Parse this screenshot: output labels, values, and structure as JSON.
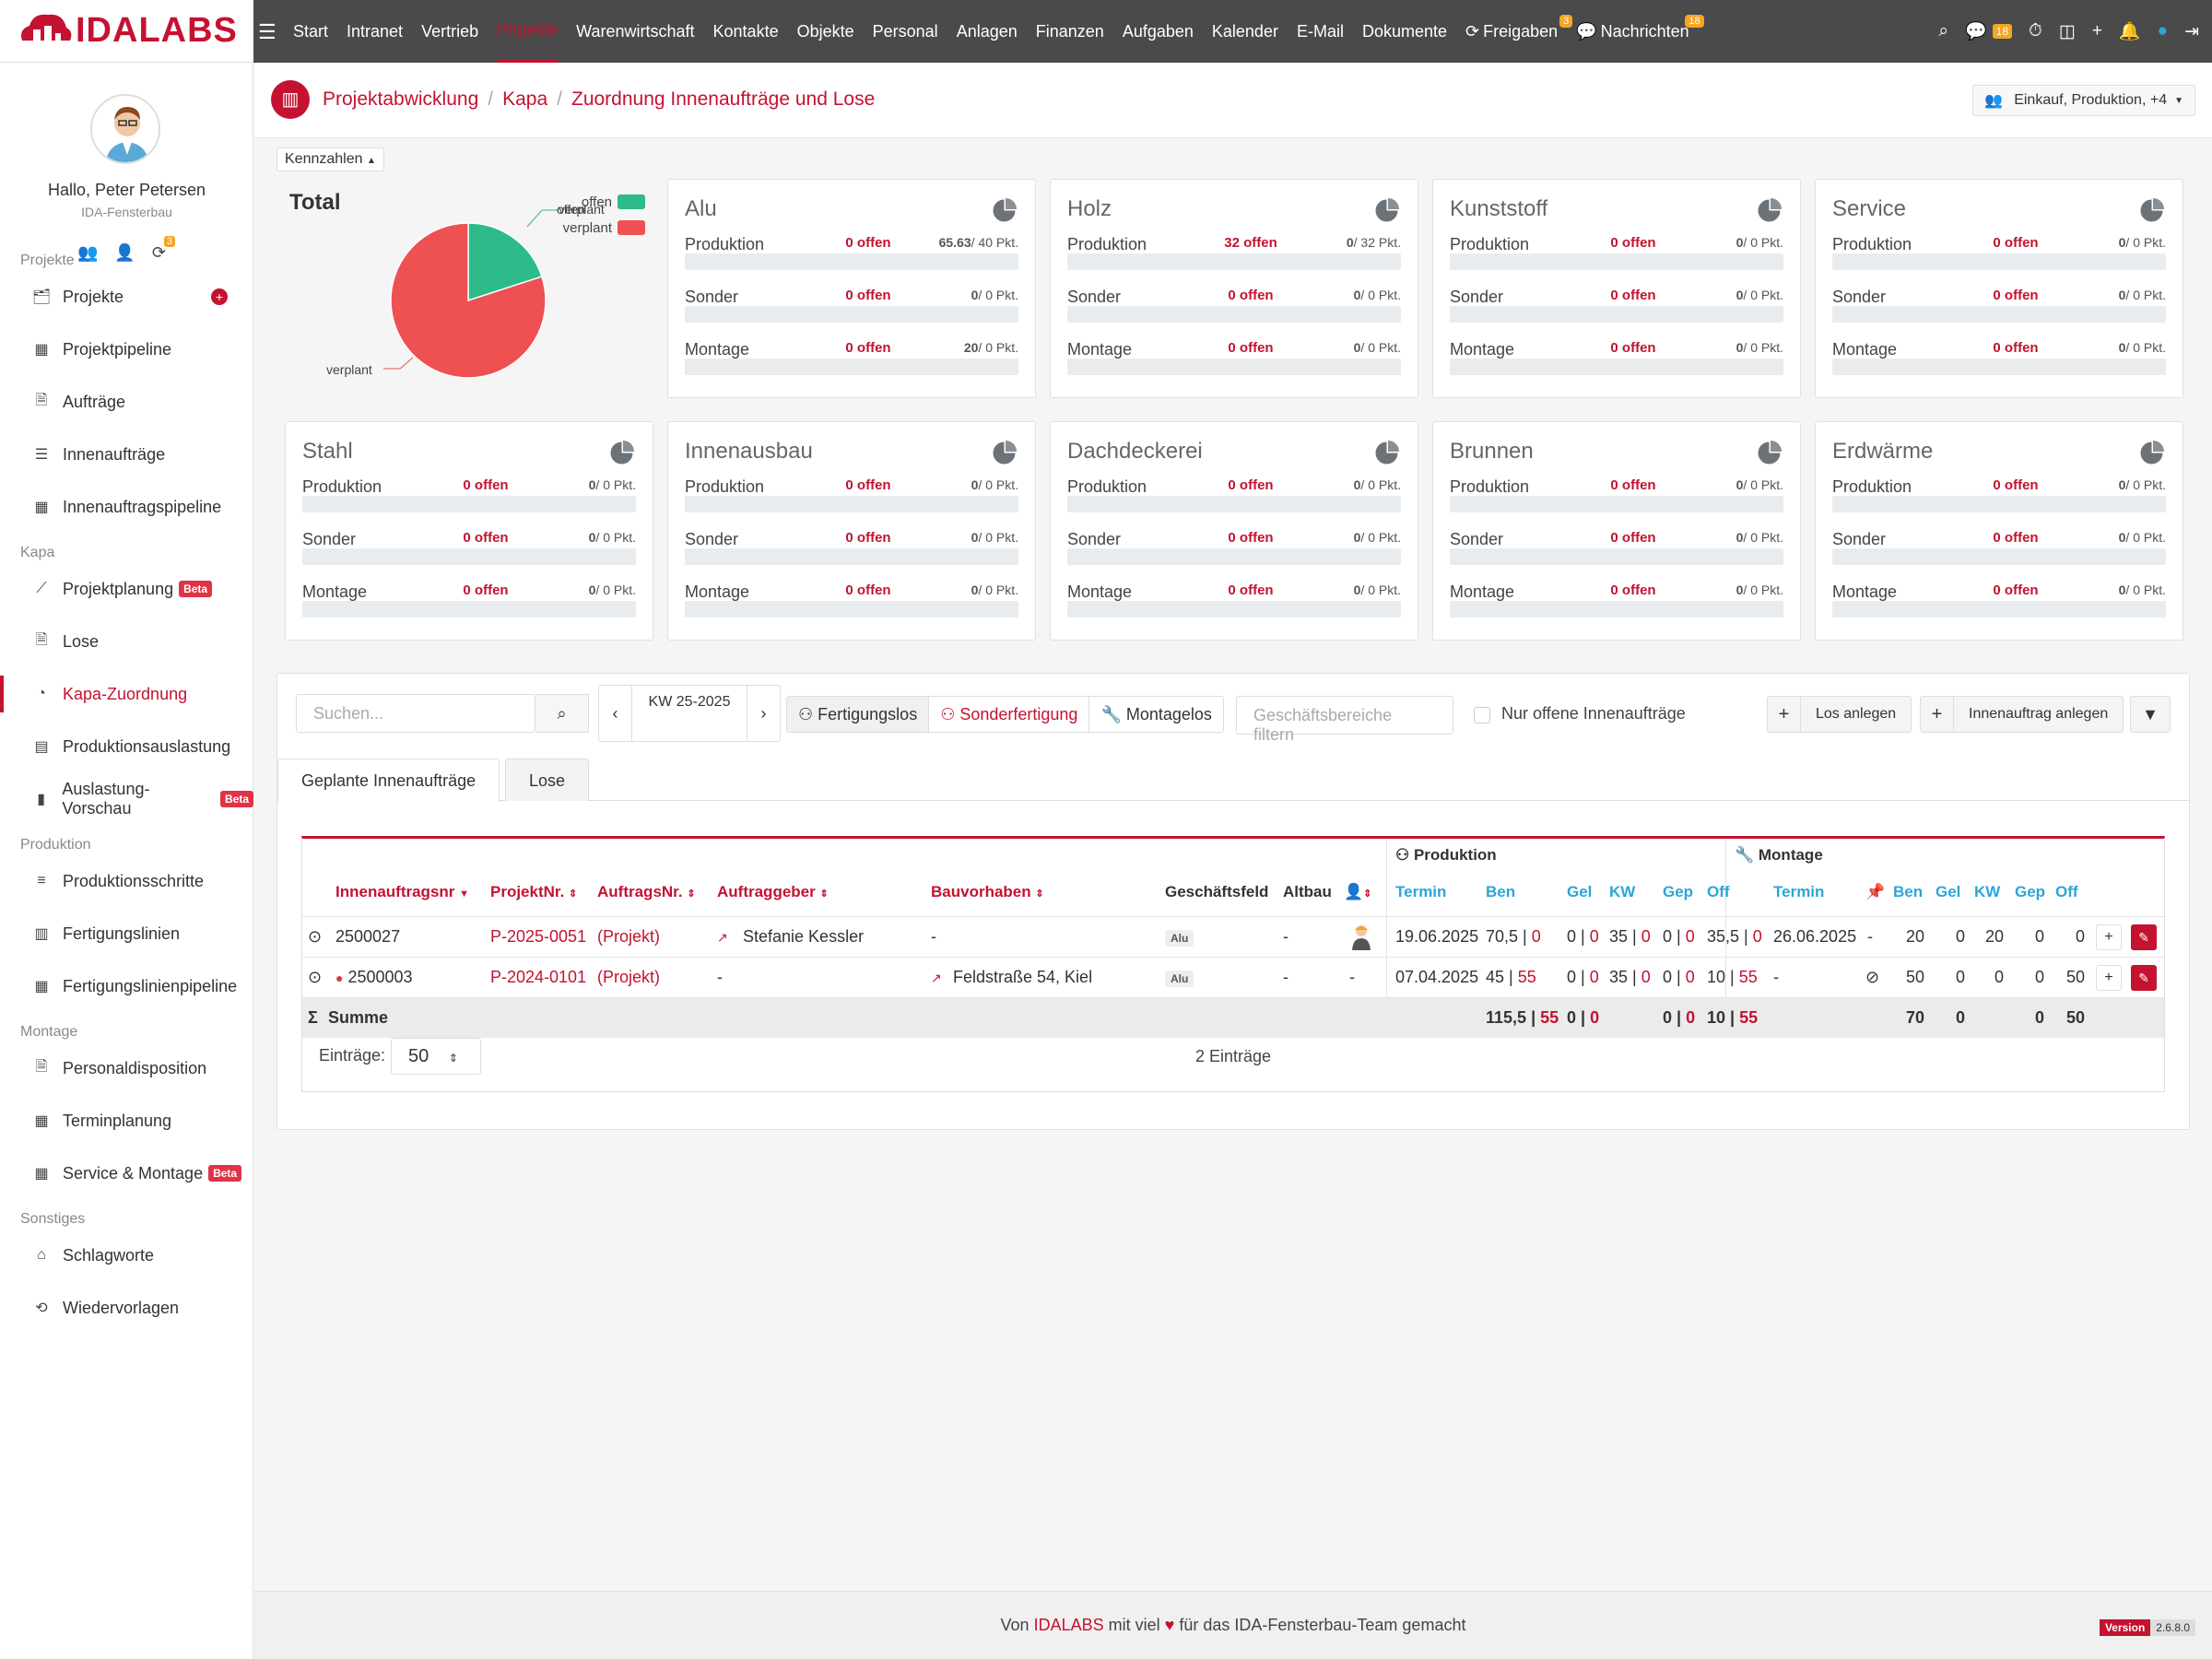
{
  "app": {
    "logo": "IDALABS"
  },
  "topnav": {
    "items": [
      "Start",
      "Intranet",
      "Vertrieb",
      "Projekte",
      "Warenwirtschaft",
      "Kontakte",
      "Objekte",
      "Personal",
      "Anlagen",
      "Finanzen",
      "Aufgaben",
      "Kalender",
      "E-Mail",
      "Dokumente",
      "Freigaben",
      "Nachrichten"
    ],
    "active": "Projekte",
    "freigaben_badge": "3",
    "nachrichten_badge": "18",
    "chat_badge": "18"
  },
  "user": {
    "greeting": "Hallo, Peter Petersen",
    "company": "IDA-Fensterbau",
    "icon_badge": "3"
  },
  "sidebar": {
    "sections": [
      {
        "title": "Projekte",
        "items": [
          {
            "label": "Projekte",
            "icon": "briefcase-icon",
            "plus": true
          },
          {
            "label": "Projektpipeline",
            "icon": "table-icon"
          },
          {
            "label": "Aufträge",
            "icon": "file-icon"
          },
          {
            "label": "Innenaufträge",
            "icon": "list-icon"
          },
          {
            "label": "Innenauftragspipeline",
            "icon": "table-icon"
          }
        ]
      },
      {
        "title": "Kapa",
        "items": [
          {
            "label": "Projektplanung",
            "icon": "chart-icon",
            "beta": "Beta"
          },
          {
            "label": "Lose",
            "icon": "file-icon"
          },
          {
            "label": "Kapa-Zuordnung",
            "icon": "pie-icon",
            "active": true
          },
          {
            "label": "Produktionsauslastung",
            "icon": "server-icon"
          },
          {
            "label": "Auslastung-Vorschau",
            "icon": "bar-chart-icon",
            "beta": "Beta"
          }
        ]
      },
      {
        "title": "Produktion",
        "items": [
          {
            "label": "Produktionsschritte",
            "icon": "steps-icon"
          },
          {
            "label": "Fertigungslinien",
            "icon": "grid-icon"
          },
          {
            "label": "Fertigungslinienpipeline",
            "icon": "table-icon"
          }
        ]
      },
      {
        "title": "Montage",
        "items": [
          {
            "label": "Personaldisposition",
            "icon": "file-icon"
          },
          {
            "label": "Terminplanung",
            "icon": "table-icon"
          },
          {
            "label": "Service & Montage",
            "icon": "table-icon",
            "beta": "Beta"
          }
        ]
      },
      {
        "title": "Sonstiges",
        "items": [
          {
            "label": "Schlagworte",
            "icon": "tag-icon"
          },
          {
            "label": "Wiedervorlagen",
            "icon": "recycle-icon"
          }
        ]
      }
    ]
  },
  "breadcrumb": {
    "items": [
      "Projektabwicklung",
      "Kapa",
      "Zuordnung Innenaufträge und Lose"
    ]
  },
  "user_filter": {
    "label": "Einkauf, Produktion, +4"
  },
  "kennzahlen": {
    "toggle": "Kennzahlen",
    "total_title": "Total",
    "legend": [
      {
        "name": "offen",
        "color": "#2dbb8c"
      },
      {
        "name": "verplant",
        "color": "#ef5052"
      }
    ],
    "pie_labels": {
      "a": "offen",
      "b": "verplant",
      "c": "verplant"
    }
  },
  "chart_data": {
    "type": "pie",
    "title": "Total",
    "categories": [
      "offen",
      "verplant"
    ],
    "values": [
      20,
      80
    ]
  },
  "cards": [
    {
      "title": "Alu",
      "rows": [
        {
          "label": "Produktion",
          "offen": "0 offen",
          "pkt_bold": "65.63",
          "pkt": "/ 40 Pkt.",
          "fill": "redstripe"
        },
        {
          "label": "Sonder",
          "offen": "0 offen",
          "pkt_bold": "0",
          "pkt": "/ 0 Pkt."
        },
        {
          "label": "Montage",
          "offen": "0 offen",
          "pkt_bold": "20",
          "pkt": "/ 0 Pkt."
        }
      ]
    },
    {
      "title": "Holz",
      "rows": [
        {
          "label": "Produktion",
          "offen": "32 offen",
          "pkt_bold": "0",
          "pkt": "/ 32 Pkt.",
          "fill": "green"
        },
        {
          "label": "Sonder",
          "offen": "0 offen",
          "pkt_bold": "0",
          "pkt": "/ 0 Pkt."
        },
        {
          "label": "Montage",
          "offen": "0 offen",
          "pkt_bold": "0",
          "pkt": "/ 0 Pkt."
        }
      ]
    },
    {
      "title": "Kunststoff",
      "rows": [
        {
          "label": "Produktion",
          "offen": "0 offen",
          "pkt_bold": "0",
          "pkt": "/ 0 Pkt."
        },
        {
          "label": "Sonder",
          "offen": "0 offen",
          "pkt_bold": "0",
          "pkt": "/ 0 Pkt."
        },
        {
          "label": "Montage",
          "offen": "0 offen",
          "pkt_bold": "0",
          "pkt": "/ 0 Pkt."
        }
      ]
    },
    {
      "title": "Service",
      "rows": [
        {
          "label": "Produktion",
          "offen": "0 offen",
          "pkt_bold": "0",
          "pkt": "/ 0 Pkt."
        },
        {
          "label": "Sonder",
          "offen": "0 offen",
          "pkt_bold": "0",
          "pkt": "/ 0 Pkt."
        },
        {
          "label": "Montage",
          "offen": "0 offen",
          "pkt_bold": "0",
          "pkt": "/ 0 Pkt."
        }
      ]
    },
    {
      "title": "Stahl",
      "rows": [
        {
          "label": "Produktion",
          "offen": "0 offen",
          "pkt_bold": "0",
          "pkt": "/ 0 Pkt."
        },
        {
          "label": "Sonder",
          "offen": "0 offen",
          "pkt_bold": "0",
          "pkt": "/ 0 Pkt."
        },
        {
          "label": "Montage",
          "offen": "0 offen",
          "pkt_bold": "0",
          "pkt": "/ 0 Pkt."
        }
      ]
    },
    {
      "title": "Innenausbau",
      "rows": [
        {
          "label": "Produktion",
          "offen": "0 offen",
          "pkt_bold": "0",
          "pkt": "/ 0 Pkt."
        },
        {
          "label": "Sonder",
          "offen": "0 offen",
          "pkt_bold": "0",
          "pkt": "/ 0 Pkt."
        },
        {
          "label": "Montage",
          "offen": "0 offen",
          "pkt_bold": "0",
          "pkt": "/ 0 Pkt."
        }
      ]
    },
    {
      "title": "Dachdeckerei",
      "rows": [
        {
          "label": "Produktion",
          "offen": "0 offen",
          "pkt_bold": "0",
          "pkt": "/ 0 Pkt."
        },
        {
          "label": "Sonder",
          "offen": "0 offen",
          "pkt_bold": "0",
          "pkt": "/ 0 Pkt."
        },
        {
          "label": "Montage",
          "offen": "0 offen",
          "pkt_bold": "0",
          "pkt": "/ 0 Pkt."
        }
      ]
    },
    {
      "title": "Brunnen",
      "rows": [
        {
          "label": "Produktion",
          "offen": "0 offen",
          "pkt_bold": "0",
          "pkt": "/ 0 Pkt."
        },
        {
          "label": "Sonder",
          "offen": "0 offen",
          "pkt_bold": "0",
          "pkt": "/ 0 Pkt."
        },
        {
          "label": "Montage",
          "offen": "0 offen",
          "pkt_bold": "0",
          "pkt": "/ 0 Pkt."
        }
      ]
    },
    {
      "title": "Erdwärme",
      "rows": [
        {
          "label": "Produktion",
          "offen": "0 offen",
          "pkt_bold": "0",
          "pkt": "/ 0 Pkt."
        },
        {
          "label": "Sonder",
          "offen": "0 offen",
          "pkt_bold": "0",
          "pkt": "/ 0 Pkt."
        },
        {
          "label": "Montage",
          "offen": "0 offen",
          "pkt_bold": "0",
          "pkt": "/ 0 Pkt."
        }
      ]
    }
  ],
  "toolbar": {
    "search_placeholder": "Suchen...",
    "kw": "KW 25-2025",
    "buttons": [
      "Fertigungslos",
      "Sonderfertigung",
      "Montagelos"
    ],
    "filter_placeholder": "Geschäftsbereiche filtern",
    "checkbox_label": "Nur offene Innenaufträge",
    "los_anlegen": "Los anlegen",
    "innenauftrag_anlegen": "Innenauftrag anlegen"
  },
  "tabs": [
    "Geplante Innenaufträge",
    "Lose"
  ],
  "table": {
    "group_produktion": "Produktion",
    "group_montage": "Montage",
    "headers": {
      "innenauftragsnr": "Innenauftragsnr",
      "projektnr": "ProjektNr.",
      "auftragsnr": "AuftragsNr.",
      "auftraggeber": "Auftraggeber",
      "bauvorhaben": "Bauvorhaben",
      "geschaeftsfeld": "Geschäftsfeld",
      "altbau": "Altbau",
      "p_termin": "Termin",
      "p_ben": "Ben",
      "p_gel": "Gel",
      "p_kw": "KW",
      "p_gep": "Gep",
      "p_off": "Off",
      "m_termin": "Termin",
      "m_ben": "Ben",
      "m_gel": "Gel",
      "m_kw": "KW",
      "m_gep": "Gep",
      "m_off": "Off"
    },
    "rows": [
      {
        "nr": "2500027",
        "projekt": "P-2025-0051",
        "auftrag": "(Projekt)",
        "auftraggeber": "Stefanie Kessler",
        "bauvorhaben": "-",
        "feld": "Alu",
        "altbau": "-",
        "p_termin": "19.06.2025",
        "p_ben": "70,5",
        "p_ben_r": "0",
        "p_gel": "0",
        "p_gel_r": "0",
        "p_kw": "35",
        "p_kw_r": "0",
        "p_gep": "0",
        "p_gep_r": "0",
        "p_off": "35,5",
        "p_off_r": "0",
        "m_termin": "26.06.2025",
        "m_pin": "-",
        "m_ben": "20",
        "m_gel": "0",
        "m_kw": "20",
        "m_gep": "0",
        "m_off": "0"
      },
      {
        "nr": "2500003",
        "projekt": "P-2024-0101",
        "auftrag": "(Projekt)",
        "auftraggeber": "-",
        "bauvorhaben": "Feldstraße 54, Kiel",
        "feld": "Alu",
        "altbau": "-",
        "person": "-",
        "p_termin": "07.04.2025",
        "p_ben": "45",
        "p_ben_r": "55",
        "p_gel": "0",
        "p_gel_r": "0",
        "p_kw": "35",
        "p_kw_r": "0",
        "p_gep": "0",
        "p_gep_r": "0",
        "p_off": "10",
        "p_off_r": "55",
        "m_termin": "-",
        "m_ben": "50",
        "m_gel": "0",
        "m_kw": "0",
        "m_gep": "0",
        "m_off": "50"
      }
    ],
    "sum": {
      "label": "Summe",
      "p_ben": "115,5",
      "p_ben_r": "55",
      "p_gel": "0",
      "p_gel_r": "0",
      "p_gep": "0",
      "p_gep_r": "0",
      "p_off": "10",
      "p_off_r": "55",
      "m_ben": "70",
      "m_gel": "0",
      "m_gep": "0",
      "m_off": "50"
    },
    "entries_label": "Einträge:",
    "entries_value": "50",
    "count": "2 Einträge"
  },
  "footer": {
    "pre": "Von ",
    "brand": "IDALABS",
    "mid": " mit viel ",
    "post": " für das IDA-Fensterbau-Team gemacht",
    "version_label": "Version",
    "version": "2.6.8.0"
  }
}
